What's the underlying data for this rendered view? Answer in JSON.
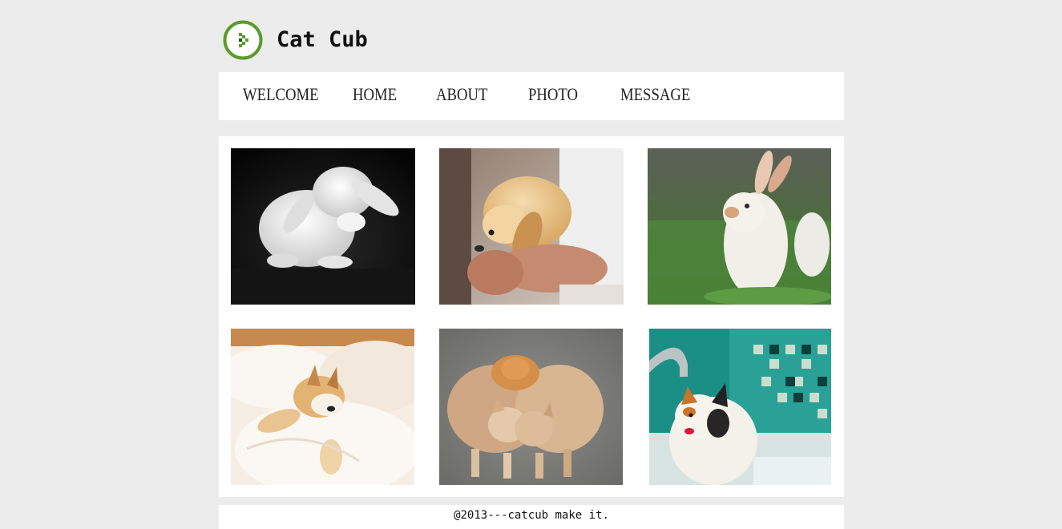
{
  "site": {
    "name": "Cat Cub",
    "accent_color": "#5a9a2a",
    "logo_icon": "green-play-circle-icon"
  },
  "nav": {
    "items": [
      {
        "label": "WELCOME"
      },
      {
        "label": "HOME"
      },
      {
        "label": "ABOUT"
      },
      {
        "label": "PHOTO"
      },
      {
        "label": "MESSAGE"
      }
    ]
  },
  "gallery": {
    "photos": [
      {
        "subject": "white rabbit grooming on dark background"
      },
      {
        "subject": "golden puppy held in hands"
      },
      {
        "subject": "white rabbit sitting in grass"
      },
      {
        "subject": "puppy sleeping on white pillow"
      },
      {
        "subject": "three tabby cats huddled together"
      },
      {
        "subject": "calico cat drinking from faucet"
      }
    ]
  },
  "footer": {
    "text": "@2013---catcub make it."
  }
}
